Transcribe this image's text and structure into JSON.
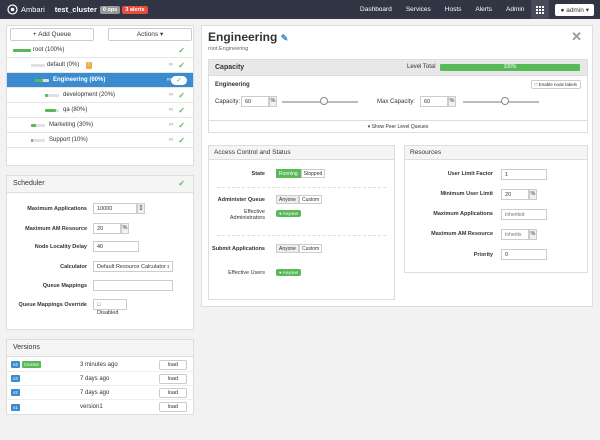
{
  "topbar": {
    "brand": "Ambari",
    "cluster": "test_cluster",
    "ops_badge": "0 ops",
    "alerts_badge": "3 alerts",
    "nav": [
      "Dashboard",
      "Services",
      "Hosts",
      "Alerts",
      "Admin"
    ],
    "user": "admin"
  },
  "queues": {
    "add_label": "+ Add Queue",
    "actions_label": "Actions",
    "items": [
      {
        "label": "root (100%)",
        "fill": 1.0
      },
      {
        "label": "default (0%)",
        "fill": 0.0
      },
      {
        "label": "Engineering (60%)",
        "fill": 0.6
      },
      {
        "label": "development (20%)",
        "fill": 0.2
      },
      {
        "label": "qa (80%)",
        "fill": 0.8
      },
      {
        "label": "Marketing (30%)",
        "fill": 0.3
      },
      {
        "label": "Support (10%)",
        "fill": 0.1
      }
    ]
  },
  "scheduler": {
    "title": "Scheduler",
    "max_apps_label": "Maximum Applications",
    "max_apps_value": "10000",
    "max_am_label": "Maximum AM Resource",
    "max_am_value": "20",
    "max_am_unit": "%",
    "locality_label": "Node Locality Delay",
    "locality_value": "40",
    "calculator_label": "Calculator",
    "calculator_value": "Default Resource Calculator",
    "mappings_label": "Queue Mappings",
    "mappings_override_label": "Queue Mappings Override",
    "mappings_override_value": "Disabled"
  },
  "versions": {
    "title": "Versions",
    "load_label": "load",
    "items": [
      {
        "tag": "v4",
        "current": "Current",
        "time": "3 minutes ago"
      },
      {
        "tag": "v3",
        "current": "",
        "time": "7 days ago"
      },
      {
        "tag": "v2",
        "current": "",
        "time": "7 days ago"
      },
      {
        "tag": "v1",
        "current": "",
        "time": "version1"
      }
    ]
  },
  "main": {
    "title": "Engineering",
    "path": "root.Engineering"
  },
  "capacity": {
    "title": "Capacity",
    "level_total_label": "Level Total",
    "level_total_value": "100%",
    "level_total_fill": 1.0,
    "queue_name": "Engineering",
    "node_labels": "Enable node labels",
    "capacity_label": "Capacity:",
    "capacity_value": "60",
    "capacity_fill": 0.6,
    "max_capacity_label": "Max Capacity:",
    "max_capacity_value": "60",
    "max_capacity_fill": 0.6,
    "unit": "%",
    "peer_levels": "Show Peer Level Queues"
  },
  "access": {
    "title": "Access Control and Status",
    "state_label": "State",
    "state_running": "Running",
    "state_stopped": "Stopped",
    "admin_queue_label": "Administer Queue",
    "anyone": "Anyone",
    "custom": "Custom",
    "effective_admins_label": "Effective Administrators",
    "effective_tag": "Anyone",
    "submit_label": "Submit Applications",
    "effective_users_label": "Effective Users"
  },
  "resources": {
    "title": "Resources",
    "user_limit_factor_label": "User Limit Factor",
    "user_limit_factor_value": "1",
    "min_user_limit_label": "Minimum User Limit",
    "min_user_limit_value": "20",
    "max_apps_label": "Maximum Applications",
    "max_apps_placeholder": "Inherited",
    "max_am_label": "Maximum AM Resource",
    "max_am_placeholder": "Inherits",
    "priority_label": "Priority",
    "priority_value": "0",
    "unit": "%"
  }
}
